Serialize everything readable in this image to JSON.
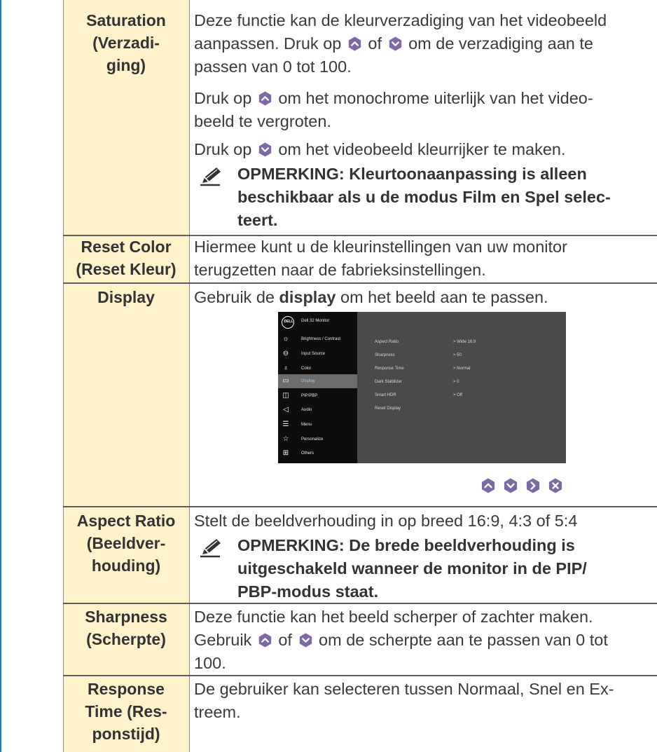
{
  "rows": [
    {
      "label": "Saturation (Verzadi-ging)",
      "label_lines": [
        "Saturation",
        "(Verzadi-",
        "ging)"
      ],
      "para1": [
        "Deze functie kan de kleurverzadiging van het videobeeld",
        "aanpassen. Druk op",
        "of",
        "om de verzadiging aan te",
        "passen van 0 tot 100."
      ],
      "para2": [
        "Druk op",
        "om het monochrome uiterlijk van het video-",
        "beeld te vergroten."
      ],
      "para3": [
        "Druk op",
        "om het videobeeld kleurrijker te maken."
      ],
      "note_lines": [
        "OPMERKING: Kleurtoonaanpassing is alleen",
        "beschikbaar als u de modus Film en Spel selec-",
        "teert."
      ]
    },
    {
      "label_lines": [
        "Reset Color",
        "(Reset Kleur)"
      ],
      "text_lines": [
        "Hiermee kunt u de kleurinstellingen van uw monitor",
        "terugzetten naar de fabrieksinstellingen."
      ]
    },
    {
      "label_lines": [
        "Display"
      ],
      "text_pre": "Gebruik de",
      "text_bold": "display",
      "text_post": "om het beeld aan te passen."
    },
    {
      "label_lines": [
        "Aspect Ratio",
        "(Beeldver-",
        "houding)"
      ],
      "text": "Stelt de beeldverhouding in op breed 16:9, 4:3 of 5:4",
      "note_lines": [
        "OPMERKING: De brede beeldverhouding is",
        "uitgeschakeld wanneer de monitor in de PIP/",
        "PBP-modus staat."
      ]
    },
    {
      "label_lines": [
        "Sharpness",
        "(Scherpte)"
      ],
      "line1": "Deze functie kan het beeld scherper of zachter maken.",
      "line2a": "Gebruik",
      "line2b": "of",
      "line2c": "om de scherpte aan te passen van 0 tot",
      "line3": "100."
    },
    {
      "label_lines": [
        "Response",
        "Time (Res-",
        "ponstijd)"
      ],
      "text_lines": [
        "De gebruiker kan selecteren tussen Normaal, Snel en Ex-",
        "treem."
      ]
    }
  ],
  "osd": {
    "logo": "DELL",
    "title": "Dell 32 Monitor",
    "menu": [
      {
        "icon": "brightness-icon",
        "label": "Brightness / Contrast"
      },
      {
        "icon": "input-source-icon",
        "label": "Input Source"
      },
      {
        "icon": "color-icon",
        "label": "Color"
      },
      {
        "icon": "display-icon",
        "label": "Display",
        "selected": true
      },
      {
        "icon": "pip-pbp-icon",
        "label": "PIP/PBP"
      },
      {
        "icon": "audio-icon",
        "label": "Audio"
      },
      {
        "icon": "menu-icon",
        "label": "Menu"
      },
      {
        "icon": "personalize-icon",
        "label": "Personalize"
      },
      {
        "icon": "others-icon",
        "label": "Others"
      }
    ],
    "settings": [
      {
        "name": "Aspect Ratio",
        "value": "> Wide 16:9"
      },
      {
        "name": "Sharpness",
        "value": "> 50"
      },
      {
        "name": "Response Time",
        "value": "> Normal"
      },
      {
        "name": "Dark Stabilizer",
        "value": "> 0"
      },
      {
        "name": "Smart HDR",
        "value": "> Off"
      },
      {
        "name": "Reset Display",
        "value": ""
      }
    ]
  },
  "nav_buttons": [
    "up-icon",
    "down-icon",
    "right-icon",
    "close-icon"
  ],
  "colors": {
    "accent": "#1a7fb5",
    "label_bg": "#fdf2c9",
    "icon_purple": "#7e6aa3"
  }
}
